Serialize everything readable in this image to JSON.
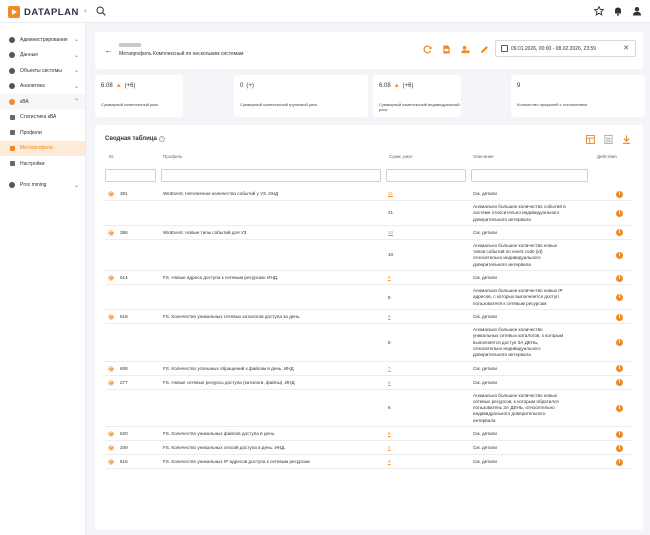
{
  "app": {
    "logo_text": "DATAPLAN"
  },
  "sidebar": {
    "items": [
      {
        "label": "Администрирование",
        "chev": "⌄"
      },
      {
        "label": "Данные",
        "chev": "⌄"
      },
      {
        "label": "Объекты системы",
        "chev": "⌄"
      },
      {
        "label": "Аналитика",
        "chev": "⌄"
      },
      {
        "label": "кВА",
        "chev": "⌃"
      },
      {
        "label": "Статистика кВА"
      },
      {
        "label": "Профили"
      },
      {
        "label": "Метапрофили"
      },
      {
        "label": "Настройки"
      },
      {
        "label": "Proc mining",
        "chev": "⌄"
      }
    ]
  },
  "header": {
    "title": "Метапрофиль Комплексный по нескольким системам",
    "date_range": "09.01.2026, 00:00 - 08.02.2026, 23:59",
    "back": "←",
    "clear": "✕"
  },
  "stats": [
    {
      "value": "6.08",
      "delta": "(+6)",
      "label": "Суммарный комплексный риск"
    },
    {
      "value": "0",
      "delta": "(+)",
      "label": "Суммарный комплексный групповой риск"
    },
    {
      "value": "6.08",
      "delta": "(+6)",
      "label": "Суммарный комплексный индивидуальный риск"
    },
    {
      "value": "9",
      "delta": "",
      "label": "Количество профилей с отклонением"
    }
  ],
  "table": {
    "title": "Сводная таблица",
    "q": "?",
    "columns": {
      "id": "ID",
      "profile": "Профиль",
      "risk": "Сумм. риск",
      "desc": "Описание",
      "actions": "Действия"
    },
    "info_glyph": "i",
    "rows": [
      {
        "id": "391",
        "profile": "WinEvent. Нетипичное количество событий у УЗ. ИНД",
        "risk": "21",
        "desc": "См. детали",
        "sub_risk": "21",
        "sub_desc": [
          "Аномально большое количество событий в",
          "системе относительно индивидуального",
          "доверительного интервала"
        ]
      },
      {
        "id": "386",
        "profile": "WinEvent. Новые типы событий для УЗ",
        "risk": "10",
        "desc": "См. детали",
        "sub_risk": "10",
        "sub_desc": [
          "Аномально большое количество новых",
          "типов событий по event code (id)",
          "относительно индивидуального",
          "доверительного интервала"
        ]
      },
      {
        "id": "614",
        "profile": "FS. Новые адреса доступа к сетевым ресурсам. ИНД.",
        "risk": "8",
        "desc": "См. детали",
        "sub_risk": "8",
        "sub_desc": [
          "Аномально большое количество новых IP",
          "адресов, с которых выполняется доступ",
          "пользователя к сетевым ресурсам"
        ]
      },
      {
        "id": "618",
        "profile": "FS. Количество уникальных сетевых каталогов доступа за день.",
        "risk": "8",
        "desc": "См. детали",
        "sub_risk": "8",
        "sub_desc": [
          "Аномально большое количество",
          "уникальных сетевых каталогов, к которым",
          "выполняется доступ ЗА ДЕНЬ,",
          "относительно индивидуального",
          "доверительного интервала"
        ]
      },
      {
        "id": "608",
        "profile": "FS. Количество успешных обращений к файлам в день. ИНД",
        "risk": "7",
        "desc": "См. детали"
      },
      {
        "id": "277",
        "profile": "FS. Новые сетевые ресурсы доступа (каталоги, файлы). ИНД",
        "risk": "6",
        "desc": "См. детали",
        "sub_risk": "6",
        "sub_desc": [
          "Аномально большое количество новых",
          "сетевых ресурсов, к которым обратился",
          "пользователь ЗА ДЕНЬ, относительно",
          "индивидуального доверительного",
          "интервала"
        ]
      },
      {
        "id": "620",
        "profile": "FS. Количество уникальных файлов доступа в день.",
        "risk": "5",
        "desc": "См. детали"
      },
      {
        "id": "349",
        "profile": "FS. Количество уникальных сессий доступа в день. ИНД.",
        "risk": "4",
        "desc": "См. детали"
      },
      {
        "id": "615",
        "profile": "FS. Количество уникальных IP адресов доступа к сетевым ресурсам",
        "risk": "4",
        "desc": "См. детали"
      }
    ]
  }
}
